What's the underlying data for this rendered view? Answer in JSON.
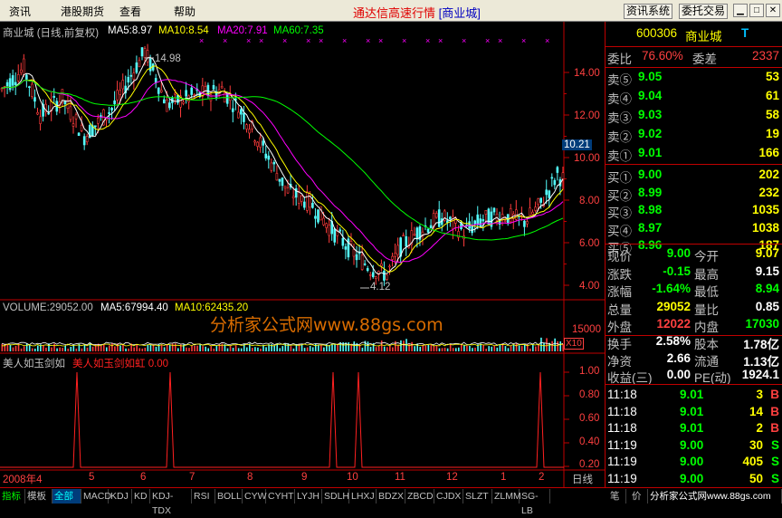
{
  "menu": {
    "items": [
      "资讯",
      "港股期货",
      "查看",
      "帮助"
    ],
    "title_main": "通达信高速行情",
    "title_stock": "[商业城]",
    "btn_info": "资讯系统",
    "btn_trade": "委托交易"
  },
  "chart": {
    "name_label": "商业城 (日线,前复权)",
    "ma5": "MA5:8.97",
    "ma10": "MA10:8.54",
    "ma20": "MA20:7.91",
    "ma60": "MA60:7.35",
    "high_label": "14.98",
    "low_label": "4.12",
    "current_price_tag": "10.21",
    "price_axis": [
      "14.00",
      "12.00",
      "10.00",
      "8.00",
      "6.00",
      "4.00"
    ],
    "vol_label": "VOLUME:29052.00",
    "vol_ma5": "MA5:67994.40",
    "vol_ma10": "MA10:62435.20",
    "vol_axis": "15000",
    "vol_unit": "X10",
    "ind_name": "美人如玉剑如",
    "ind_value": "美人如玉剑如虹 0.00",
    "ind_axis": [
      "1.00",
      "0.80",
      "0.60",
      "0.40",
      "0.20"
    ],
    "date_start": "2008年4",
    "months": [
      "5",
      "6",
      "7",
      "8",
      "9",
      "10",
      "11",
      "12",
      "1",
      "2"
    ],
    "period_label": "日线",
    "ma5_color": "#ffffff",
    "ma10_color": "#ffff00",
    "ma20_color": "#ff00ff",
    "ma60_color": "#00ff00"
  },
  "quote": {
    "code": "600306",
    "name": "商业城",
    "flag": "T",
    "weibi_label": "委比",
    "weibi": "76.60%",
    "weicha_label": "委差",
    "weicha": "2337",
    "asks": [
      {
        "label": "卖⑤",
        "price": "9.05",
        "vol": "53"
      },
      {
        "label": "卖④",
        "price": "9.04",
        "vol": "61"
      },
      {
        "label": "卖③",
        "price": "9.03",
        "vol": "58"
      },
      {
        "label": "卖②",
        "price": "9.02",
        "vol": "19"
      },
      {
        "label": "卖①",
        "price": "9.01",
        "vol": "166"
      }
    ],
    "bids": [
      {
        "label": "买①",
        "price": "9.00",
        "vol": "202"
      },
      {
        "label": "买②",
        "price": "8.99",
        "vol": "232"
      },
      {
        "label": "买③",
        "price": "8.98",
        "vol": "1035"
      },
      {
        "label": "买④",
        "price": "8.97",
        "vol": "1038"
      },
      {
        "label": "买⑤",
        "price": "8.96",
        "vol": "187"
      }
    ],
    "stats": [
      {
        "l1": "现价",
        "v1": "9.00",
        "l2": "今开",
        "v2": "9.07"
      },
      {
        "l1": "涨跌",
        "v1": "-0.15",
        "l2": "最高",
        "v2": "9.15"
      },
      {
        "l1": "涨幅",
        "v1": "-1.64%",
        "l2": "最低",
        "v2": "8.94"
      },
      {
        "l1": "总量",
        "v1": "29052",
        "l2": "量比",
        "v2": "0.85"
      },
      {
        "l1": "外盘",
        "v1": "12022",
        "l2": "内盘",
        "v2": "17030"
      }
    ],
    "stats2": [
      {
        "l1": "换手",
        "v1": "2.58%",
        "l2": "股本",
        "v2": "1.78亿"
      },
      {
        "l1": "净资",
        "v1": "2.66",
        "l2": "流通",
        "v2": "1.13亿"
      },
      {
        "l1": "收益(三)",
        "v1": "0.00",
        "l2": "PE(动)",
        "v2": "1924.1"
      }
    ],
    "ticks": [
      {
        "time": "11:18",
        "price": "9.01",
        "vol": "3",
        "dir": "B"
      },
      {
        "time": "11:18",
        "price": "9.01",
        "vol": "14",
        "dir": "B"
      },
      {
        "time": "11:18",
        "price": "9.01",
        "vol": "2",
        "dir": "B"
      },
      {
        "time": "11:19",
        "price": "9.00",
        "vol": "30",
        "dir": "S"
      },
      {
        "time": "11:19",
        "price": "9.00",
        "vol": "405",
        "dir": "S"
      },
      {
        "time": "11:19",
        "price": "9.00",
        "vol": "50",
        "dir": "S"
      }
    ]
  },
  "tabs": [
    "指标",
    "模板",
    "全部",
    "MACD",
    "KDJ",
    "KD",
    "KDJ-TDX",
    "RSI",
    "BOLL",
    "CYW",
    "CYHT",
    "LYJH",
    "SDLH",
    "LHXJ",
    "BDZX",
    "ZBCD",
    "CJDX",
    "SLZT",
    "ZLMM",
    "SG-LB"
  ],
  "status": {
    "left": "笔",
    "mid": "价",
    "site": "分析家公式网www.88gs.com"
  },
  "watermark": "分析家公式网www.88gs.com"
}
